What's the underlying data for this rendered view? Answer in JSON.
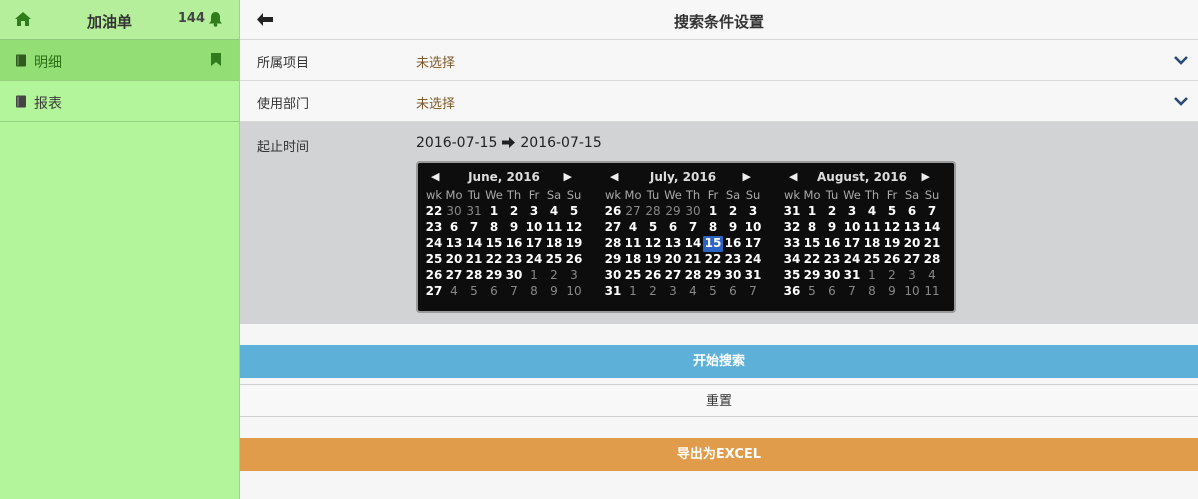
{
  "sidebar": {
    "title": "加油单",
    "count": "144",
    "items": [
      {
        "label": "明细",
        "active": true
      },
      {
        "label": "报表",
        "active": false
      }
    ]
  },
  "header": {
    "title": "搜索条件设置"
  },
  "form": {
    "project_label": "所属项目",
    "project_value": "未选择",
    "dept_label": "使用部门",
    "dept_value": "未选择",
    "date_label": "起止时间",
    "date_from": "2016-07-15",
    "date_to": "2016-07-15"
  },
  "calendar": {
    "prev_glyph": "◀",
    "next_glyph": "▶",
    "dow": [
      "wk",
      "Mo",
      "Tu",
      "We",
      "Th",
      "Fr",
      "Sa",
      "Su"
    ],
    "months": [
      {
        "title": "June, 2016",
        "weeks": [
          [
            "22",
            "30*",
            "31*",
            "1",
            "2",
            "3",
            "4",
            "5"
          ],
          [
            "23",
            "6",
            "7",
            "8",
            "9",
            "10",
            "11",
            "12"
          ],
          [
            "24",
            "13",
            "14",
            "15",
            "16",
            "17",
            "18",
            "19"
          ],
          [
            "25",
            "20",
            "21",
            "22",
            "23",
            "24",
            "25",
            "26"
          ],
          [
            "26",
            "27",
            "28",
            "29",
            "30",
            "1*",
            "2*",
            "3*"
          ],
          [
            "27",
            "4*",
            "5*",
            "6*",
            "7*",
            "8*",
            "9*",
            "10*"
          ]
        ]
      },
      {
        "title": "July, 2016",
        "weeks": [
          [
            "26",
            "27*",
            "28*",
            "29*",
            "30*",
            "1",
            "2",
            "3"
          ],
          [
            "27",
            "4",
            "5",
            "6",
            "7",
            "8",
            "9",
            "10"
          ],
          [
            "28",
            "11",
            "12",
            "13",
            "14",
            "15!",
            "16",
            "17"
          ],
          [
            "29",
            "18",
            "19",
            "20",
            "21",
            "22",
            "23",
            "24"
          ],
          [
            "30",
            "25",
            "26",
            "27",
            "28",
            "29",
            "30",
            "31"
          ],
          [
            "31",
            "1*",
            "2*",
            "3*",
            "4*",
            "5*",
            "6*",
            "7*"
          ]
        ]
      },
      {
        "title": "August, 2016",
        "weeks": [
          [
            "31",
            "1",
            "2",
            "3",
            "4",
            "5",
            "6",
            "7"
          ],
          [
            "32",
            "8",
            "9",
            "10",
            "11",
            "12",
            "13",
            "14"
          ],
          [
            "33",
            "15",
            "16",
            "17",
            "18",
            "19",
            "20",
            "21"
          ],
          [
            "34",
            "22",
            "23",
            "24",
            "25",
            "26",
            "27",
            "28"
          ],
          [
            "35",
            "29",
            "30",
            "31",
            "1*",
            "2*",
            "3*",
            "4*"
          ],
          [
            "36",
            "5*",
            "6*",
            "7*",
            "8*",
            "9*",
            "10*",
            "11*"
          ]
        ]
      }
    ]
  },
  "buttons": {
    "search": "开始搜索",
    "reset": "重置",
    "export": "导出为EXCEL"
  },
  "colors": {
    "sidebar_bg": "#b3f59a",
    "search_button": "#5db0d8",
    "export_button": "#e09c4a",
    "selected_day": "#2c64c4"
  }
}
